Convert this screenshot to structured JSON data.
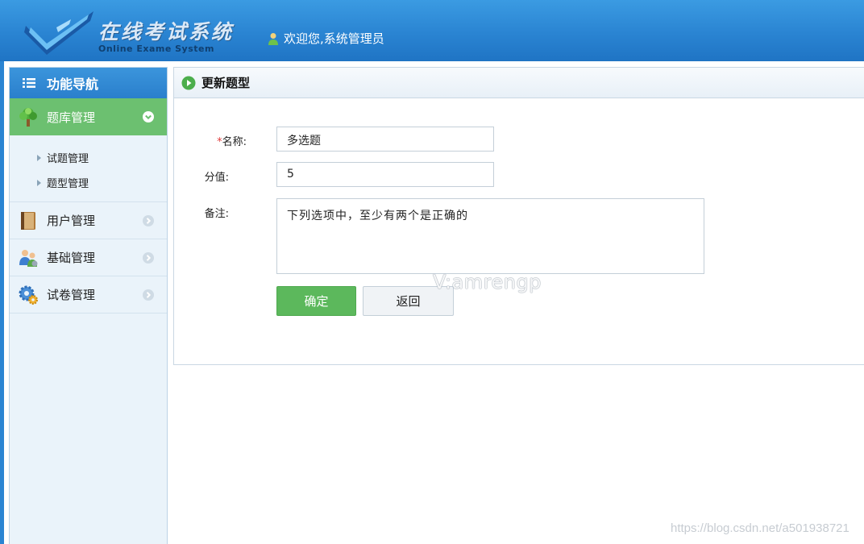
{
  "header": {
    "logo_title": "在线考试系统",
    "logo_subtitle": "Online Exame System",
    "welcome_text": "欢迎您,系统管理员"
  },
  "sidebar": {
    "title": "功能导航",
    "groups": [
      {
        "label": "题库管理",
        "icon": "tree-icon",
        "expanded": true,
        "items": [
          {
            "label": "试题管理"
          },
          {
            "label": "题型管理"
          }
        ]
      },
      {
        "label": "用户管理",
        "icon": "book-icon",
        "expanded": false
      },
      {
        "label": "基础管理",
        "icon": "users-icon",
        "expanded": false
      },
      {
        "label": "试卷管理",
        "icon": "gear-icon",
        "expanded": false
      }
    ]
  },
  "main": {
    "title": "更新题型",
    "form": {
      "name_required_mark": "*",
      "name_label": "名称:",
      "name_value": "多选题",
      "score_label": "分值:",
      "score_value": "5",
      "remark_label": "备注:",
      "remark_value": "下列选项中，至少有两个是正确的"
    },
    "buttons": {
      "confirm": "确定",
      "back": "返回"
    }
  },
  "watermarks": {
    "overlay": "V:amrengp",
    "footer": "https://blog.csdn.net/a501938721"
  },
  "colors": {
    "header_blue": "#2a84d2",
    "active_green": "#6cc070",
    "confirm_green": "#5cb85c",
    "required_red": "#e03c3c"
  }
}
